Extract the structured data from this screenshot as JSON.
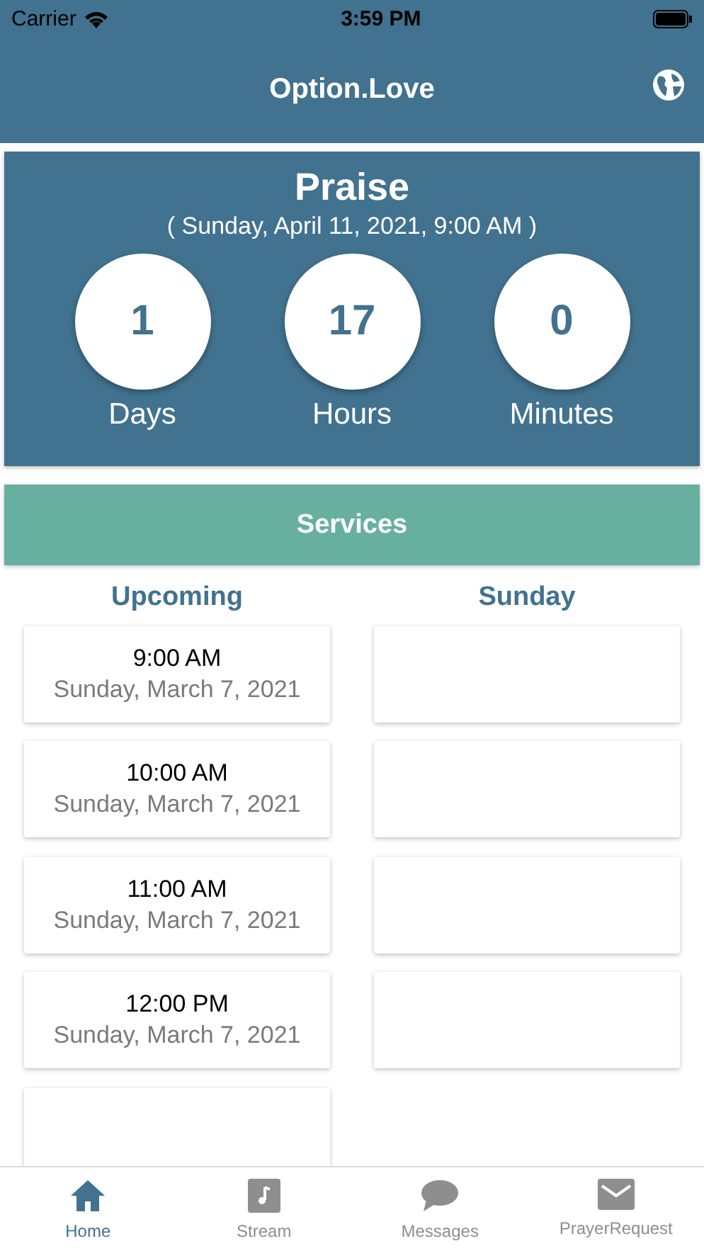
{
  "status_bar": {
    "carrier": "Carrier",
    "time": "3:59 PM"
  },
  "header": {
    "title": "Option.Love"
  },
  "event": {
    "title": "Praise",
    "date": "( Sunday, April 11, 2021,  9:00 AM )",
    "countdown": [
      {
        "value": "1",
        "unit": "Days"
      },
      {
        "value": "17",
        "unit": "Hours"
      },
      {
        "value": "0",
        "unit": "Minutes"
      }
    ]
  },
  "services_button": "Services",
  "columns": [
    {
      "heading": "Upcoming",
      "cards": [
        {
          "kind": "service",
          "time": "9:00 AM",
          "date": "Sunday, March 7, 2021"
        },
        {
          "kind": "service",
          "time": "10:00 AM",
          "date": "Sunday, March 7, 2021"
        },
        {
          "kind": "service",
          "time": "11:00 AM",
          "date": "Sunday, March 7, 2021"
        },
        {
          "kind": "service",
          "time": "12:00 PM",
          "date": "Sunday, March 7, 2021"
        },
        {
          "kind": "empty"
        }
      ]
    },
    {
      "heading": "Sunday",
      "cards": [
        {
          "kind": "empty"
        },
        {
          "kind": "empty"
        },
        {
          "kind": "empty"
        },
        {
          "kind": "empty"
        }
      ]
    }
  ],
  "tabs": [
    {
      "kind": "home",
      "label": "Home",
      "selected": true
    },
    {
      "kind": "stream",
      "label": "Stream",
      "selected": false
    },
    {
      "kind": "messages",
      "label": "Messages",
      "selected": false
    },
    {
      "kind": "mail",
      "label": "PrayerRequest",
      "selected": false
    }
  ]
}
